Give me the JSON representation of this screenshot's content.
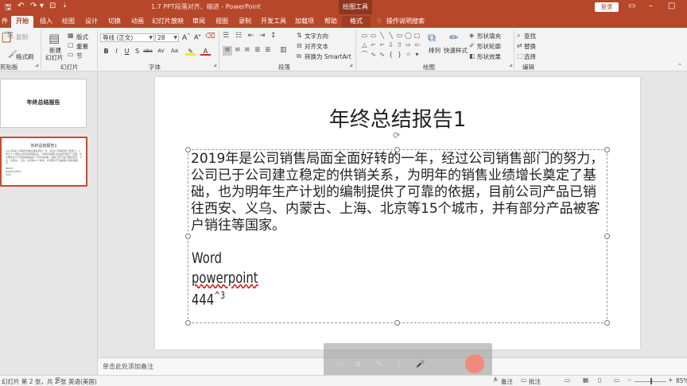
{
  "titlebar": {
    "doc_title": "1.7 PPT段落对齐、缩进 - PowerPoint",
    "context_tools": "绘图工具",
    "login": "登录"
  },
  "tabs": [
    "件",
    "开始",
    "插入",
    "绘图",
    "设计",
    "切换",
    "动画",
    "幻灯片放映",
    "审阅",
    "视图",
    "录制",
    "开发工具",
    "加载项",
    "帮助",
    "格式"
  ],
  "tell_me": "操作说明搜索",
  "ribbon": {
    "clipboard": {
      "copy": "复制",
      "paste_fmt": "格式刷",
      "group": "剪贴板"
    },
    "slides": {
      "new_slide_l1": "新建",
      "new_slide_l2": "幻灯片",
      "layout": "版式",
      "reset": "重置",
      "section": "节",
      "group": "幻灯片"
    },
    "font": {
      "name": "等线 (正文)",
      "size": "28",
      "group": "字体",
      "bold": "B",
      "italic": "I",
      "underline": "U",
      "shadow": "S",
      "strike": "abc",
      "spacing": "AV",
      "case": "Aa",
      "color": "A"
    },
    "paragraph": {
      "text_direction": "文字方向",
      "align_text": "对齐文本",
      "smartart": "转换为 SmartArt",
      "group": "段落"
    },
    "drawing": {
      "arrange": "排列",
      "quick_styles": "快速样式",
      "fill": "形状填充",
      "outline": "形状轮廓",
      "effects": "形状效果",
      "group": "绘图"
    },
    "editing": {
      "find": "查找",
      "replace": "替换",
      "select": "选择",
      "group": "编辑"
    }
  },
  "thumbnails": {
    "slide1_num": "1",
    "slide1_title": "年终总结报告",
    "slide2_num": "2",
    "slide2_title": "年终总结报告1"
  },
  "slide": {
    "title": "年终总结报告1",
    "body": "2019年是公司销售局面全面好转的一年，经过公司销售部门的努力，公司已于公司建立稳定的供销关系，为明年的销售业绩增长奠定了基础，也为明年生产计划的编制提供了可靠的依据，目前公司产品已销往西安、义乌、内蒙古、上海、北京等15个城市，并有部分产品被客户销往等国家。",
    "line_word": "Word",
    "line_powerpoint": "powerpoint",
    "line_444": "444",
    "line_444_sup": "^3"
  },
  "notes_placeholder": "单击此处添加备注",
  "status": {
    "slide_info": "幻灯片 第 2 张，共 2 张",
    "language": "英语(美国)",
    "notes": "备注",
    "comments": "批注",
    "zoom": "85%"
  },
  "colors": {
    "accent": "#b7472a",
    "selection": "#d24726"
  }
}
